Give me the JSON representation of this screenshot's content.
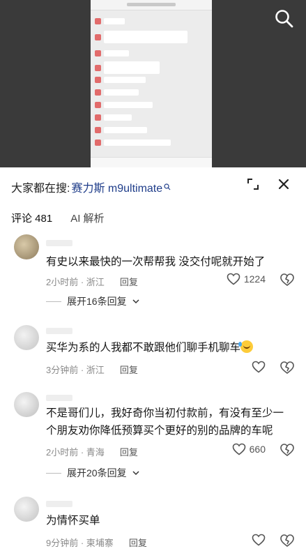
{
  "search": {
    "prefix": "大家都在搜:",
    "keyword": "赛力斯 m9ultimate"
  },
  "tabs": [
    {
      "label": "评论 481",
      "active": true
    },
    {
      "label": "AI 解析",
      "active": false
    }
  ],
  "comments": [
    {
      "text": "有史以来最快的一次帮帮我 没交付呢就开始了",
      "time": "2小时前",
      "location": "浙江",
      "reply": "回复",
      "likes": "1224",
      "expand": "展开16条回复"
    },
    {
      "text": "买华为系的人我都不敢跟他们聊手机聊车",
      "emoji": "laugh-cry-emoji",
      "time": "3分钟前",
      "location": "浙江",
      "reply": "回复"
    },
    {
      "text": "不是哥们儿，我好奇你当初付款前，有没有至少一个朋友劝你降低预算买个更好的别的品牌的车呢",
      "time": "2小时前",
      "location": "青海",
      "reply": "回复",
      "likes": "660",
      "expand": "展开20条回复"
    },
    {
      "text": "为情怀买单",
      "time": "9分钟前",
      "location": "柬埔寨",
      "reply": "回复"
    }
  ],
  "colors": {
    "keyword": "#1f3d8a",
    "meta": "#8a8a8a",
    "video_bg": "#3a3a3a"
  }
}
